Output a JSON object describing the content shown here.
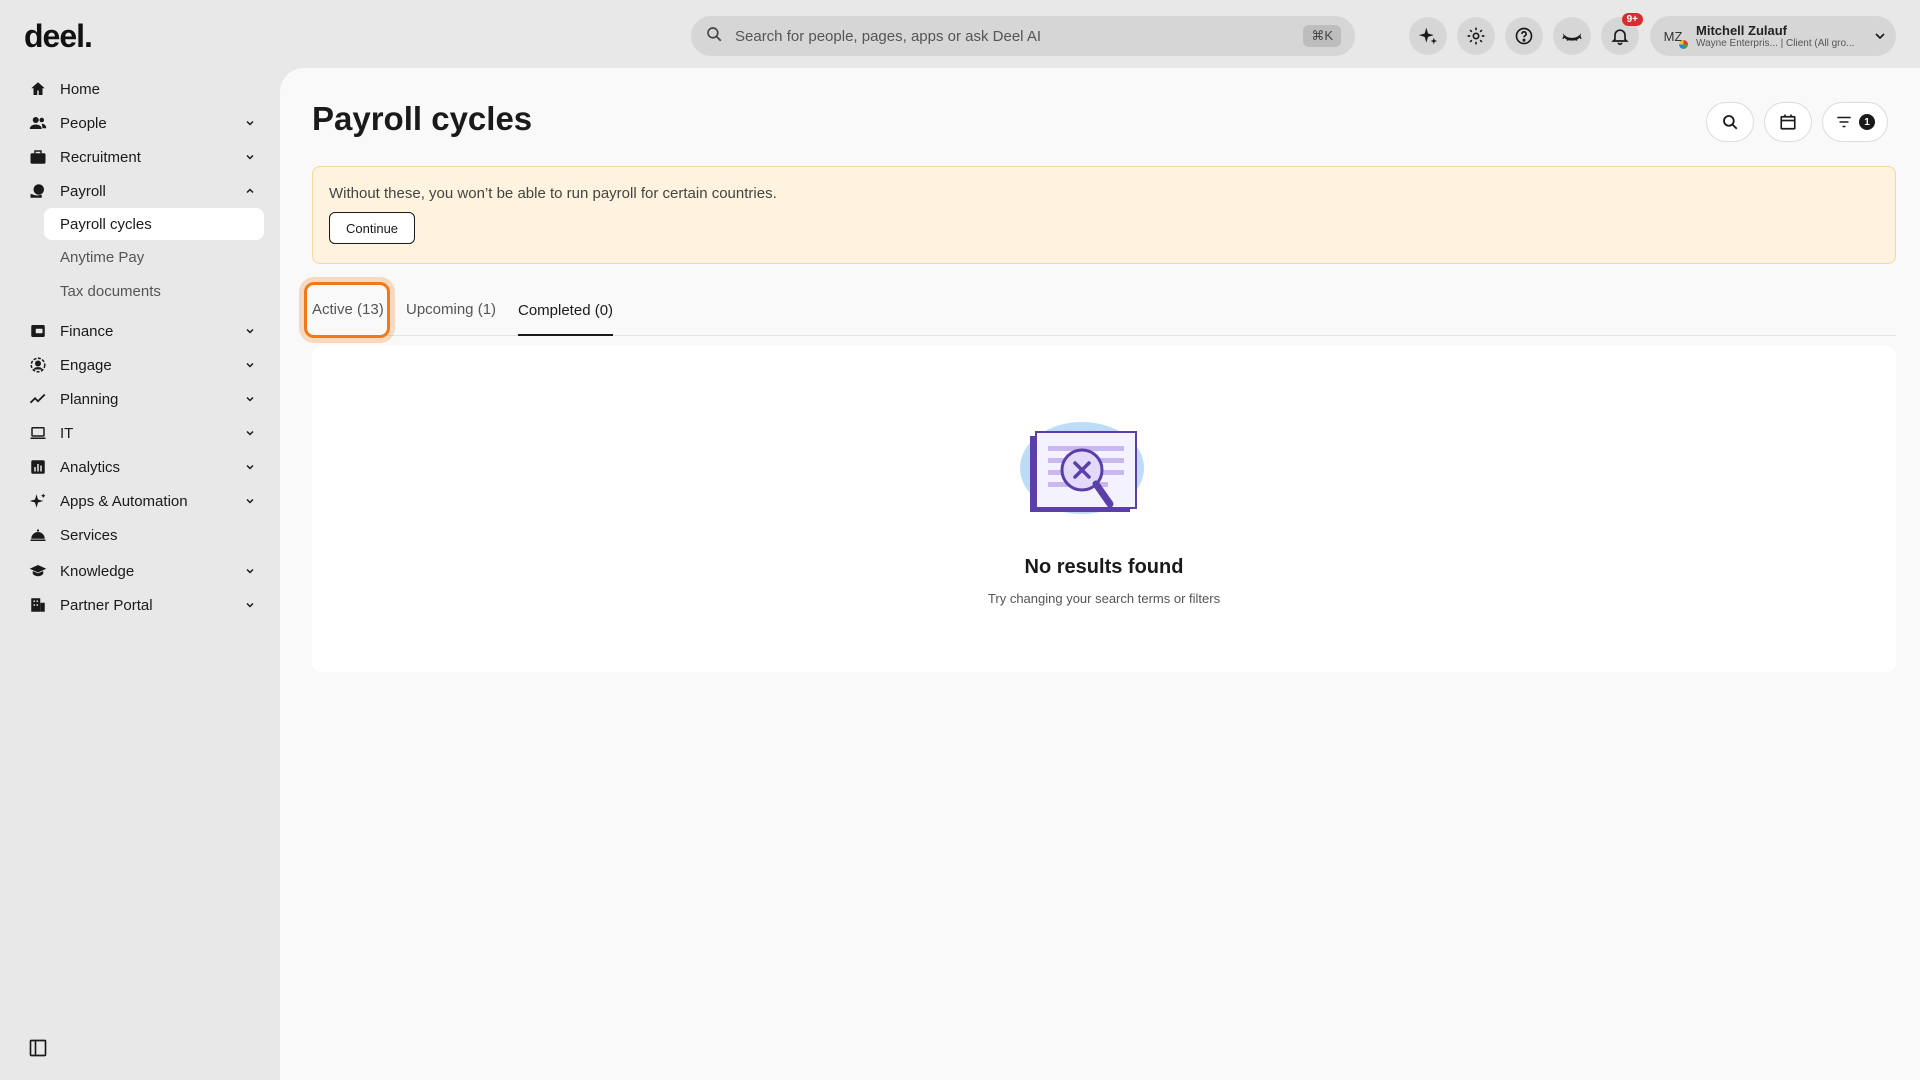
{
  "app": {
    "logo": "deel."
  },
  "search": {
    "placeholder": "Search for people, pages, apps or ask Deel AI",
    "shortcut": "⌘K"
  },
  "topbar": {
    "notifications_badge": "9+"
  },
  "user": {
    "initials": "MZ",
    "name": "Mitchell Zulauf",
    "subtitle": "Wayne Enterpris... | Client (All gro..."
  },
  "sidebar": {
    "items": [
      {
        "label": "Home",
        "icon": "home-icon",
        "expandable": false
      },
      {
        "label": "People",
        "icon": "people-icon",
        "expandable": true
      },
      {
        "label": "Recruitment",
        "icon": "briefcase-icon",
        "expandable": true
      },
      {
        "label": "Payroll",
        "icon": "payroll-icon",
        "expanded": true
      },
      {
        "label": "Finance",
        "icon": "finance-icon",
        "expandable": true
      },
      {
        "label": "Engage",
        "icon": "engage-icon",
        "expandable": true
      },
      {
        "label": "Planning",
        "icon": "planning-icon",
        "expandable": true
      },
      {
        "label": "IT",
        "icon": "laptop-icon",
        "expandable": true
      },
      {
        "label": "Analytics",
        "icon": "analytics-icon",
        "expandable": true
      },
      {
        "label": "Apps & Automation",
        "icon": "sparkle-icon",
        "expandable": true
      },
      {
        "label": "Services",
        "icon": "services-icon",
        "expandable": false
      },
      {
        "label": "Knowledge",
        "icon": "graduation-icon",
        "expandable": true
      },
      {
        "label": "Partner Portal",
        "icon": "building-icon",
        "expandable": true
      }
    ],
    "payroll_sub": [
      "Payroll cycles",
      "Anytime Pay",
      "Tax documents"
    ]
  },
  "page": {
    "title": "Payroll cycles",
    "filter_count": "1"
  },
  "banner": {
    "text": "Without these, you won’t be able to run payroll for certain countries.",
    "button": "Continue"
  },
  "tabs": [
    "Active (13)",
    "Upcoming (1)",
    "Completed (0)"
  ],
  "empty": {
    "title": "No results found",
    "subtitle": "Try changing your search terms or filters"
  },
  "colors": {
    "highlight": "#f07a1a",
    "banner_bg": "#fdf3de",
    "badge": "#d32f2f"
  }
}
